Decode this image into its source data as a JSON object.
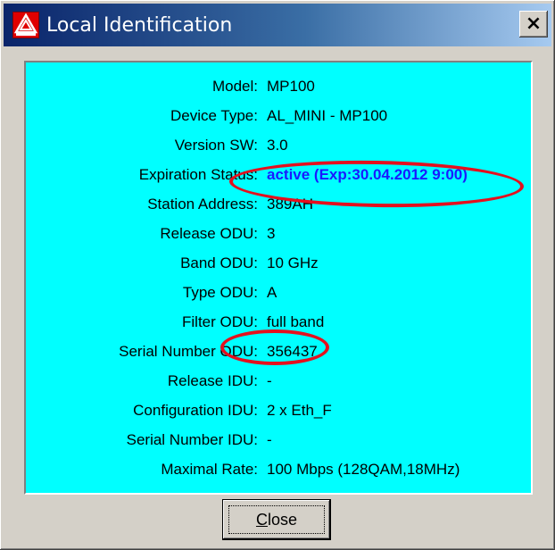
{
  "window": {
    "title": "Local Identification",
    "close_glyph": "×",
    "icon": "app-logo-icon"
  },
  "fields": [
    {
      "label": "Model:",
      "value": "MP100"
    },
    {
      "label": "Device Type:",
      "value": "AL_MINI - MP100"
    },
    {
      "label": "Version SW:",
      "value": "3.0"
    },
    {
      "label": "Expiration Status:",
      "value": "active (Exp:30.04.2012 9:00)"
    },
    {
      "label": "Station Address:",
      "value": "389AH"
    },
    {
      "label": "Release ODU:",
      "value": "3"
    },
    {
      "label": "Band ODU:",
      "value": "10 GHz"
    },
    {
      "label": "Type ODU:",
      "value": "A"
    },
    {
      "label": "Filter ODU:",
      "value": "full band"
    },
    {
      "label": "Serial Number ODU:",
      "value": "356437"
    },
    {
      "label": "Release IDU:",
      "value": "-"
    },
    {
      "label": "Configuration IDU:",
      "value": "2 x Eth_F"
    },
    {
      "label": "Serial Number IDU:",
      "value": "-"
    },
    {
      "label": "Maximal Rate:",
      "value": "100 Mbps (128QAM,18MHz)"
    }
  ],
  "buttons": {
    "close_label_first": "C",
    "close_label_rest": "lose"
  },
  "colors": {
    "panel_bg": "#00ffff",
    "active_status": "#1a1aff",
    "annotation": "#e4101e"
  }
}
